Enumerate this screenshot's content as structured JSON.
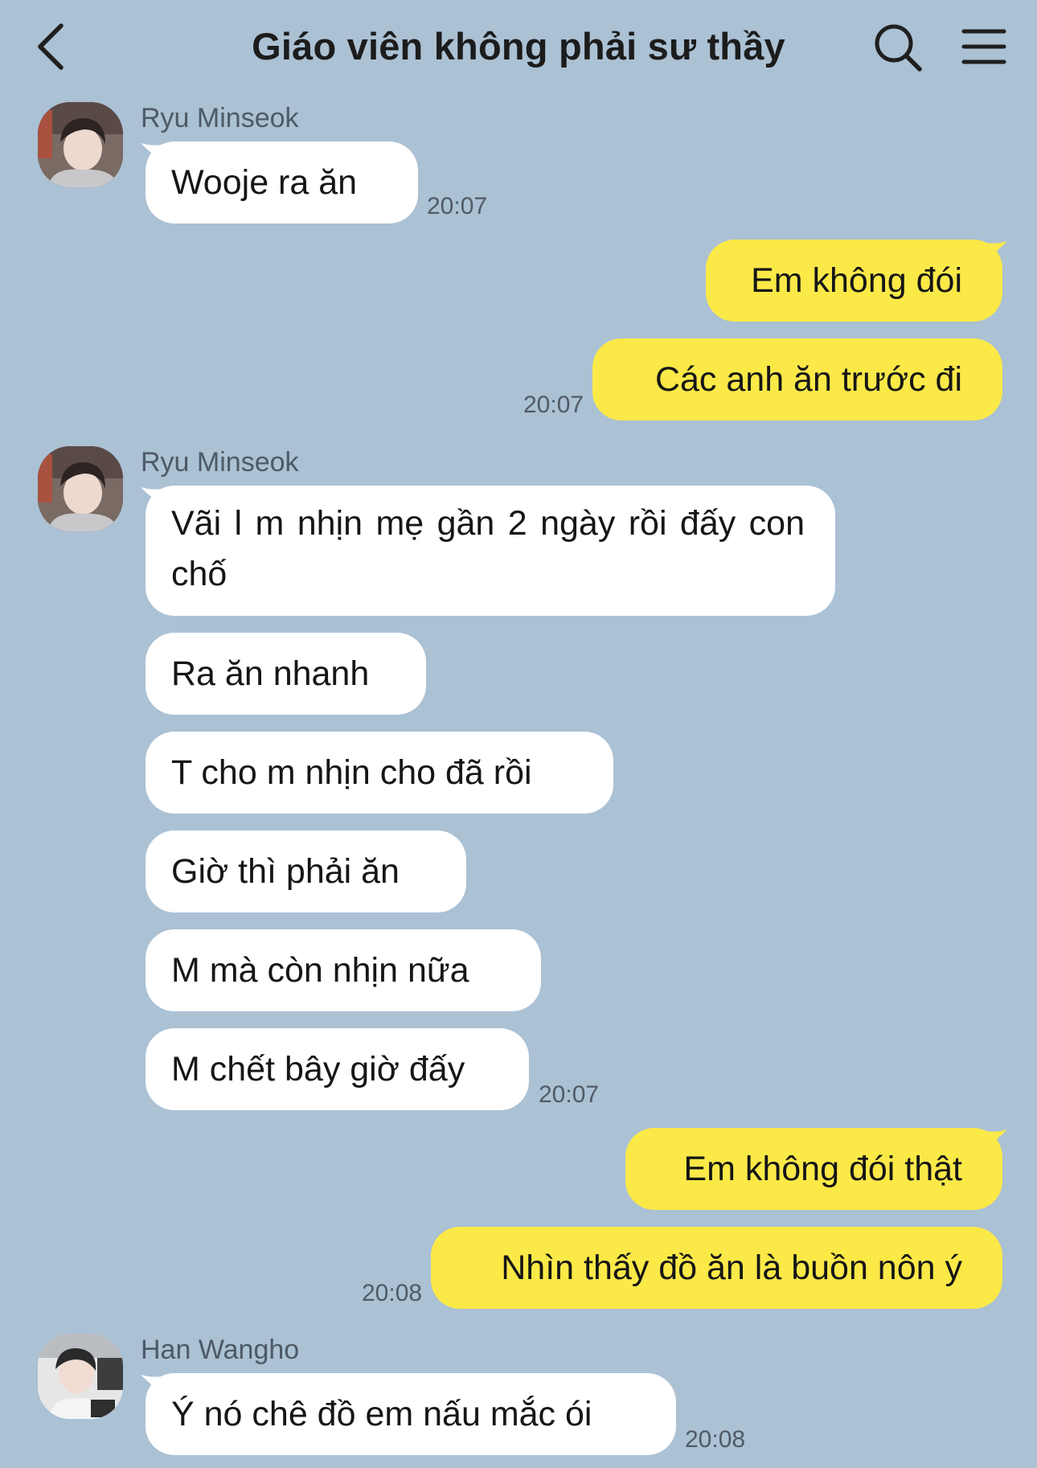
{
  "header": {
    "title": "Giáo viên không phải sư thầy",
    "back_icon": "chevron-left-icon",
    "search_icon": "search-icon",
    "menu_icon": "hamburger-menu-icon"
  },
  "colors": {
    "background": "#abc1d4",
    "incoming_bubble": "#ffffff",
    "outgoing_bubble": "#fbe948"
  },
  "messages": [
    {
      "sender": "Ryu Minseok",
      "direction": "in",
      "text": "Wooje ra ăn",
      "time": "20:07"
    },
    {
      "direction": "out",
      "text": "Em không đói",
      "time": ""
    },
    {
      "direction": "out",
      "text": "Các anh ăn trước đi",
      "time": "20:07"
    },
    {
      "sender": "Ryu Minseok",
      "direction": "in",
      "text": "Vãi l m nhịn mẹ gần 2 ngày rồi đấy con chố",
      "time": ""
    },
    {
      "direction": "in",
      "text": "Ra ăn nhanh",
      "time": ""
    },
    {
      "direction": "in",
      "text": "T cho m nhịn cho đã rồi",
      "time": ""
    },
    {
      "direction": "in",
      "text": "Giờ thì phải ăn",
      "time": ""
    },
    {
      "direction": "in",
      "text": "M mà còn nhịn nữa",
      "time": ""
    },
    {
      "direction": "in",
      "text": "M chết bây giờ đấy",
      "time": "20:07"
    },
    {
      "direction": "out",
      "text": "Em không đói thật",
      "time": ""
    },
    {
      "direction": "out",
      "text": "Nhìn thấy đồ ăn là buồn nôn ý",
      "time": "20:08"
    },
    {
      "sender": "Han Wangho",
      "direction": "in",
      "text": "Ý nó chê đồ em nấu mắc ói",
      "time": "20:08"
    }
  ]
}
